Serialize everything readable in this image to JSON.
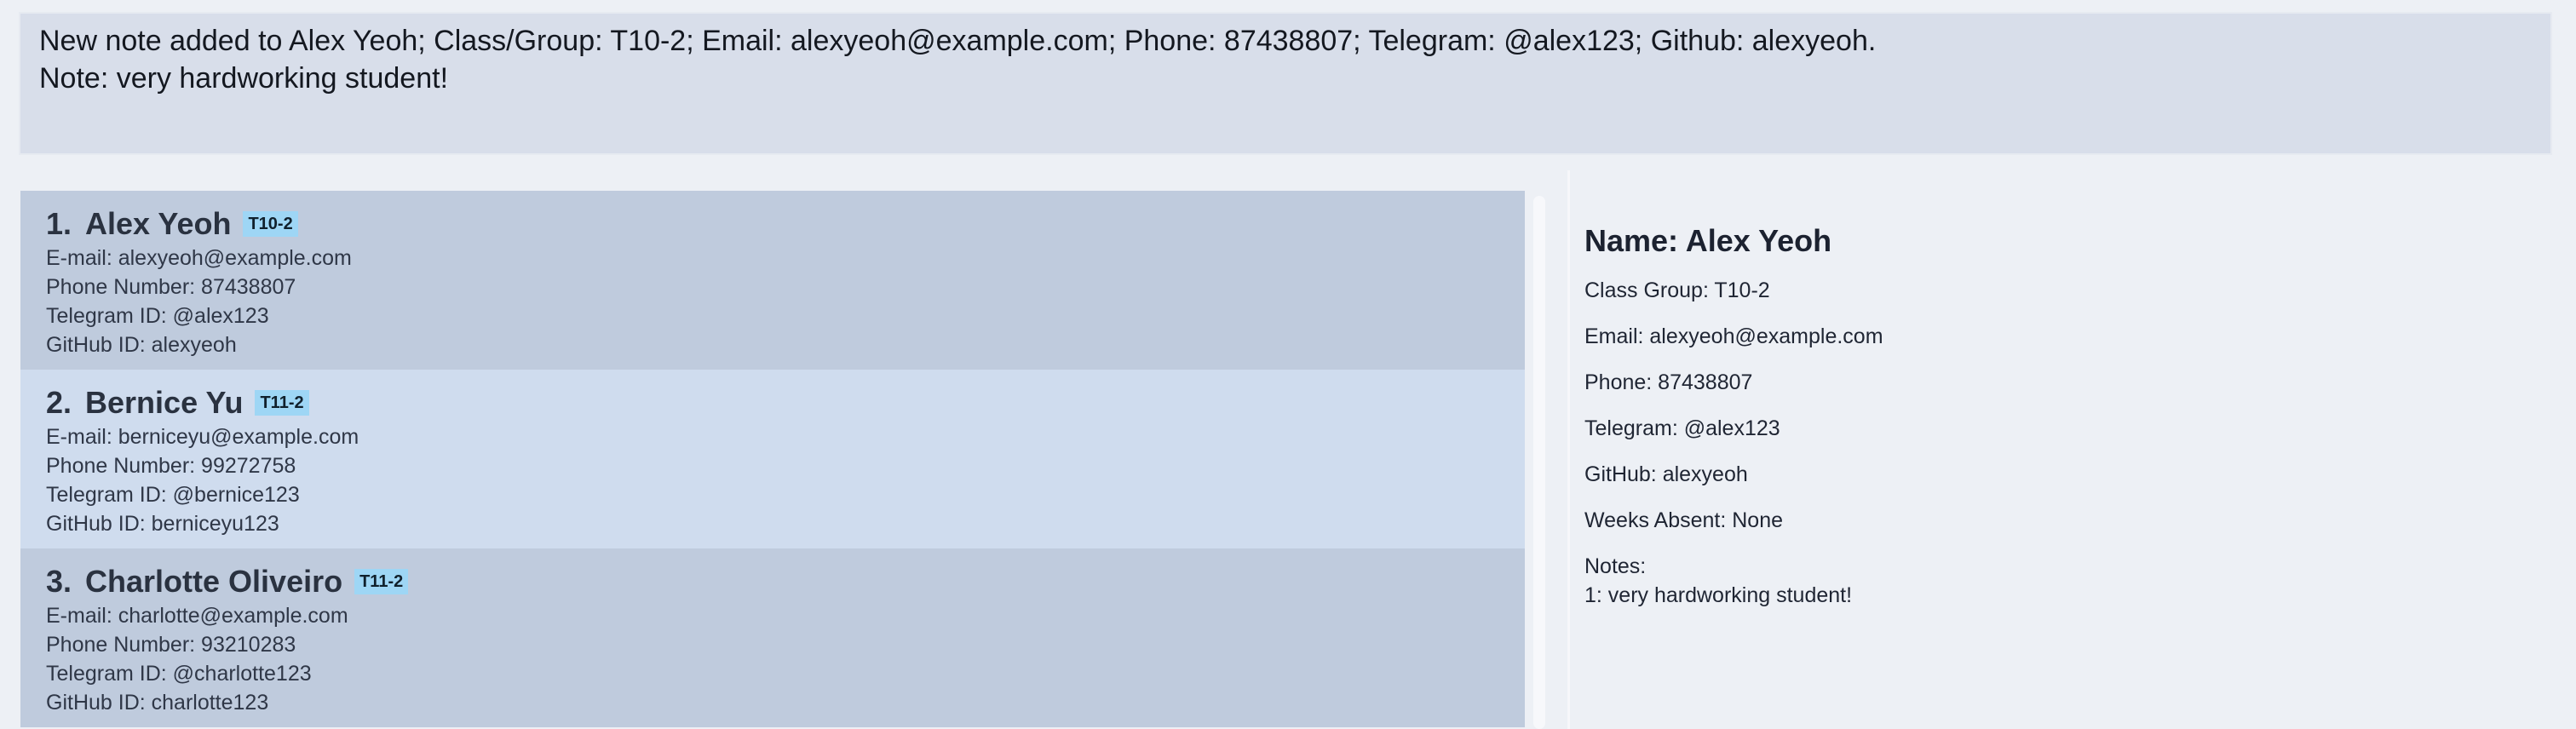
{
  "result": {
    "line1": "New note added to Alex Yeoh; Class/Group: T10-2; Email: alexyeoh@example.com; Phone: 87438807; Telegram: @alex123; Github: alexyeoh.",
    "line2": "Note: very hardworking student!"
  },
  "persons": [
    {
      "index": "1.",
      "name": "Alex Yeoh",
      "tag": "T10-2",
      "email": "E-mail: alexyeoh@example.com",
      "phone": "Phone Number: 87438807",
      "telegram": "Telegram ID: @alex123",
      "github": "GitHub ID: alexyeoh"
    },
    {
      "index": "2.",
      "name": "Bernice Yu",
      "tag": "T11-2",
      "email": "E-mail: berniceyu@example.com",
      "phone": "Phone Number: 99272758",
      "telegram": "Telegram ID: @bernice123",
      "github": "GitHub ID: berniceyu123"
    },
    {
      "index": "3.",
      "name": "Charlotte Oliveiro",
      "tag": "T11-2",
      "email": "E-mail: charlotte@example.com",
      "phone": "Phone Number: 93210283",
      "telegram": "Telegram ID: @charlotte123",
      "github": "GitHub ID: charlotte123"
    }
  ],
  "detail": {
    "name": "Name: Alex Yeoh",
    "class_group": "Class Group: T10-2",
    "email": "Email: alexyeoh@example.com",
    "phone": "Phone: 87438807",
    "telegram": "Telegram: @alex123",
    "github": "GitHub: alexyeoh",
    "weeks_absent": "Weeks Absent: None",
    "notes_label": "Notes:",
    "notes": [
      "1: very hardworking student!"
    ]
  },
  "colors": {
    "background": "#edf0f5",
    "result_box": "#d8deea",
    "card_odd": "#bfcbdd",
    "card_even": "#cfdcee",
    "tag": "#9ed6f5"
  }
}
